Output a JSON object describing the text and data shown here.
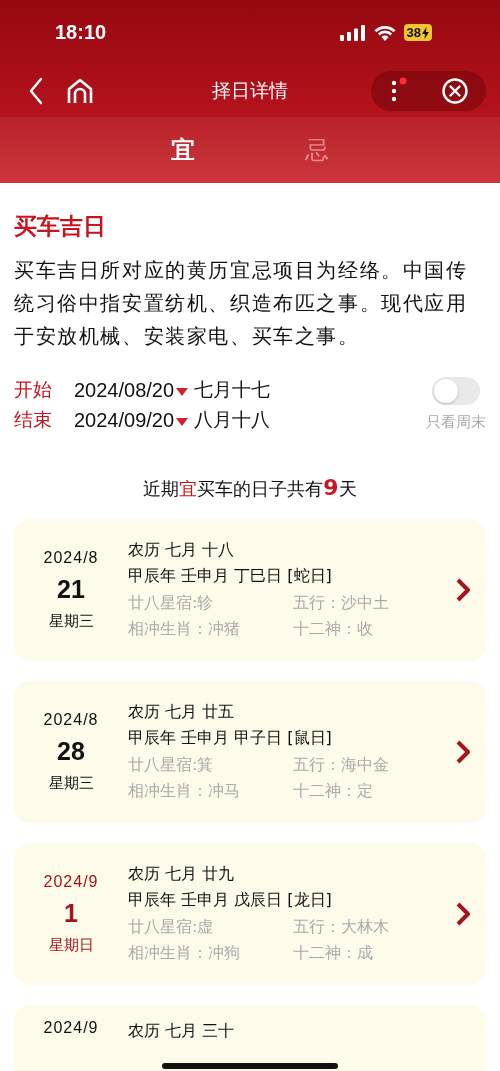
{
  "status_bar": {
    "time": "18:10",
    "battery": "38"
  },
  "nav": {
    "title": "择日详情"
  },
  "tabs": [
    {
      "label": "宜",
      "selected": true
    },
    {
      "label": "忌",
      "selected": false
    }
  ],
  "heading": "买车吉日",
  "description": "买车吉日所对应的黄历宜忌项目为经络。中国传统习俗中指安置纺机、织造布匹之事。现代应用于安放机械、安装家电、买车之事。",
  "range": [
    {
      "label": "开始",
      "date": "2024/08/20",
      "lunar": "七月十七"
    },
    {
      "label": "结束",
      "date": "2024/09/20",
      "lunar": "八月十八"
    }
  ],
  "weekend_toggle": {
    "on": false,
    "label": "只看周末"
  },
  "summary": [
    {
      "kind": "plain",
      "text": "近期"
    },
    {
      "kind": "accent",
      "text": "宜"
    },
    {
      "kind": "plain",
      "text": "买车的日子共有"
    },
    {
      "kind": "count",
      "text": "9"
    },
    {
      "kind": "plain",
      "text": "天"
    }
  ],
  "days": [
    {
      "month": "2024/8",
      "day": "21",
      "weekday": "星期三",
      "weekend": false,
      "lunar": "农历 七月 十八",
      "ganzhi": "甲辰年 壬申月 丁巳日 [蛇日]",
      "details": [
        "廿八星宿:轸",
        "五行：沙中土",
        "相冲生肖：冲猪",
        "十二神：收"
      ]
    },
    {
      "month": "2024/8",
      "day": "28",
      "weekday": "星期三",
      "weekend": false,
      "lunar": "农历 七月 廿五",
      "ganzhi": "甲辰年 壬申月 甲子日 [鼠日]",
      "details": [
        "廿八星宿:箕",
        "五行：海中金",
        "相冲生肖：冲马",
        "十二神：定"
      ]
    },
    {
      "month": "2024/9",
      "day": "1",
      "weekday": "星期日",
      "weekend": true,
      "lunar": "农历 七月 廿九",
      "ganzhi": "甲辰年 壬申月 戊辰日 [龙日]",
      "details": [
        "廿八星宿:虚",
        "五行：大林木",
        "相冲生肖：冲狗",
        "十二神：成"
      ]
    },
    {
      "month": "2024/9",
      "weekend": false,
      "lunar": "农历 七月 三十"
    }
  ]
}
